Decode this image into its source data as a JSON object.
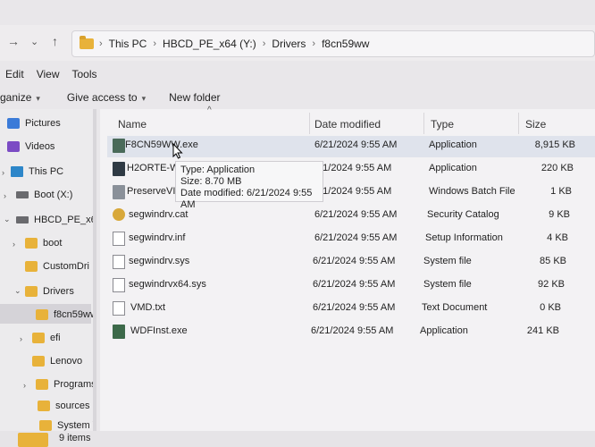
{
  "address": {
    "crumbs": [
      "This PC",
      "HBCD_PE_x64 (Y:)",
      "Drivers",
      "f8cn59ww"
    ]
  },
  "menu": [
    "Edit",
    "View",
    "Tools"
  ],
  "toolbar": {
    "organize": "ganize",
    "give_access": "Give access to",
    "new_folder": "New folder"
  },
  "nav": {
    "pictures": "Pictures",
    "videos": "Videos",
    "this_pc": "This PC",
    "boot_x": "Boot (X:)",
    "hbcd": "HBCD_PE_x6",
    "boot": "boot",
    "customdri": "CustomDri",
    "drivers": "Drivers",
    "f8cn59ww": "f8cn59ww",
    "efi": "efi",
    "lenovo": "Lenovo",
    "programs": "Programs",
    "sources": "sources",
    "system_vol": "System Vol"
  },
  "columns": {
    "name": "Name",
    "date": "Date modified",
    "type": "Type",
    "size": "Size"
  },
  "files": [
    {
      "name": "F8CN59WW.exe",
      "date": "6/21/2024 9:55 AM",
      "type": "Application",
      "size": "8,915 KB"
    },
    {
      "name": "H2ORTE-W",
      "date": "/21/2024 9:55 AM",
      "type": "Application",
      "size": "220 KB"
    },
    {
      "name": "PreserveVI",
      "date": "/21/2024 9:55 AM",
      "type": "Windows Batch File",
      "size": "1 KB"
    },
    {
      "name": "segwindrv.cat",
      "date": "6/21/2024 9:55 AM",
      "type": "Security Catalog",
      "size": "9 KB"
    },
    {
      "name": "segwindrv.inf",
      "date": "6/21/2024 9:55 AM",
      "type": "Setup Information",
      "size": "4 KB"
    },
    {
      "name": "segwindrv.sys",
      "date": "6/21/2024 9:55 AM",
      "type": "System file",
      "size": "85 KB"
    },
    {
      "name": "segwindrvx64.sys",
      "date": "6/21/2024 9:55 AM",
      "type": "System file",
      "size": "92 KB"
    },
    {
      "name": "VMD.txt",
      "date": "6/21/2024 9:55 AM",
      "type": "Text Document",
      "size": "0 KB"
    },
    {
      "name": "WDFInst.exe",
      "date": "6/21/2024 9:55 AM",
      "type": "Application",
      "size": "241 KB"
    }
  ],
  "tooltip": {
    "type": "Type: Application",
    "size": "Size: 8.70 MB",
    "date": "Date modified: 6/21/2024 9:55 AM"
  },
  "status": {
    "count": "9 items"
  },
  "colors": {
    "folder": "#e8b23a",
    "selection": "#dfe3ec"
  }
}
